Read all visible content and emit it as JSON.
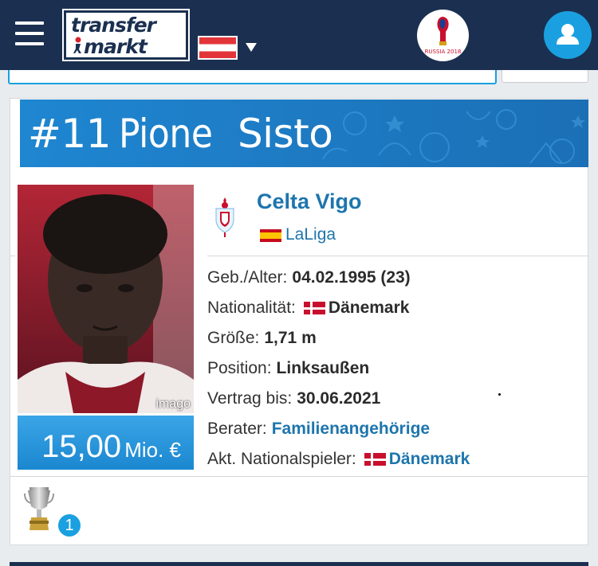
{
  "header": {
    "logo_line1": "transfer",
    "logo_line2": "markt",
    "country_flag": "austria-flag",
    "event_badge_text": "RUSSIA 2018",
    "colors": {
      "navbar": "#1b3050",
      "accent": "#1aa0e0"
    }
  },
  "player": {
    "number": "#11",
    "first_name": "Pione",
    "last_name": "Sisto",
    "photo_credit": "imago",
    "market_value": "15,00",
    "market_value_unit": "Mio. €",
    "club": "Celta Vigo",
    "league": "LaLiga",
    "info": [
      {
        "label": "Geb./Alter:",
        "value": "04.02.1995 (23)",
        "flag": "",
        "link": false
      },
      {
        "label": "Nationalität:",
        "value": "Dänemark",
        "flag": "denmark",
        "link": false
      },
      {
        "label": "Größe:",
        "value": "1,71 m",
        "flag": "",
        "link": false
      },
      {
        "label": "Position:",
        "value": "Linksaußen",
        "flag": "",
        "link": false
      },
      {
        "label": "Vertrag bis:",
        "value": "30.06.2021",
        "flag": "",
        "link": false
      },
      {
        "label": "Berater:",
        "value": "Familienangehörige",
        "flag": "",
        "link": true
      },
      {
        "label": "Akt. Nationalspieler:",
        "value": "Dänemark",
        "flag": "denmark",
        "link": true
      }
    ],
    "trophy_count": "1"
  }
}
